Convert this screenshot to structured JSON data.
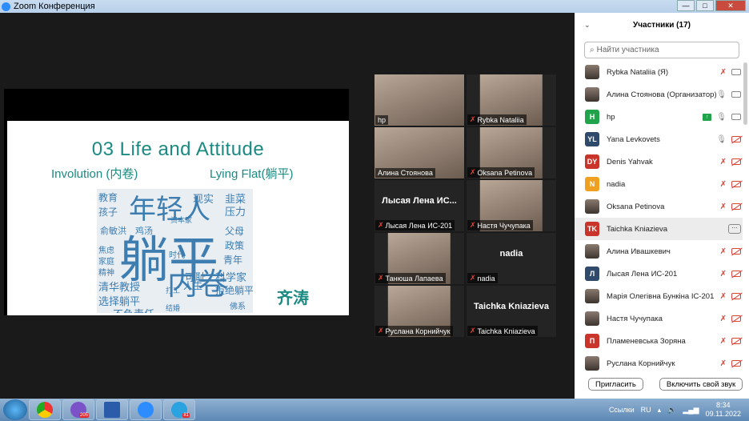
{
  "window": {
    "title": "Zoom Конференция"
  },
  "slide": {
    "title": "03 Life and Attitude",
    "sub_left": "Involution (内卷)",
    "sub_right": "Lying Flat(躺平)",
    "author": "齐涛",
    "cloud": [
      "躺平",
      "年轻人",
      "内卷",
      "教育",
      "孩子",
      "俞敏洪",
      "鸡汤",
      "现实",
      "韭菜",
      "压力",
      "父母",
      "政策",
      "青年",
      "科学家",
      "可耻",
      "拒绝躺平",
      "清华教授",
      "选择躺平",
      "不负责任",
      "人生",
      "精神",
      "家庭",
      "焦虑",
      "时代",
      "打工",
      "结婚",
      "佛系",
      "资本家"
    ]
  },
  "tiles": [
    {
      "name": "hp",
      "big": "",
      "video": true,
      "active": true,
      "muted": false
    },
    {
      "name": "Rybka Nataliia",
      "big": "",
      "video": true,
      "muted": true
    },
    {
      "name": "Алина Стоянова",
      "big": "",
      "video": true,
      "full": true,
      "muted": false
    },
    {
      "name": "Oksana Petinova",
      "big": "",
      "video": true,
      "muted": true
    },
    {
      "name": "Лысая Лена ИС-201",
      "big": "Лысая Лена ИС...",
      "video": false,
      "muted": true
    },
    {
      "name": "Настя Чучупака",
      "big": "",
      "video": true,
      "muted": true
    },
    {
      "name": "Танюша Лапаева",
      "big": "",
      "video": true,
      "muted": true
    },
    {
      "name": "nadia",
      "big": "nadia",
      "video": false,
      "muted": true
    },
    {
      "name": "Руслана Корнийчук",
      "big": "",
      "video": true,
      "muted": true
    },
    {
      "name": "Taichka Kniazieva",
      "big": "Taichka Kniazieva",
      "video": false,
      "muted": true
    }
  ],
  "panel": {
    "title": "Участники (17)",
    "search_placeholder": "Найти участника",
    "invite": "Пригласить",
    "unmute": "Включить свой звук",
    "more": "···",
    "participants": [
      {
        "name": "Rybka Nataliia (Я)",
        "initials": "",
        "color": "",
        "mic": "off",
        "cam": "on"
      },
      {
        "name": "Алина Стоянова (Организатор)",
        "initials": "",
        "color": "",
        "mic": "on",
        "cam": "on"
      },
      {
        "name": "hp",
        "initials": "H",
        "color": "#21a34b",
        "mic": "on",
        "cam": "on",
        "sharing": true
      },
      {
        "name": "Yana Levkovets",
        "initials": "YL",
        "color": "#2f4a6b",
        "mic": "on",
        "cam": "off"
      },
      {
        "name": "Denis Yahvak",
        "initials": "DY",
        "color": "#c9352b",
        "mic": "off",
        "cam": "off"
      },
      {
        "name": "nadia",
        "initials": "N",
        "color": "#f0a020",
        "mic": "off",
        "cam": "off"
      },
      {
        "name": "Oksana Petinova",
        "initials": "",
        "color": "",
        "mic": "off",
        "cam": "off"
      },
      {
        "name": "Taichka Kniazieva",
        "initials": "TK",
        "color": "#c9352b",
        "selected": true
      },
      {
        "name": "Алина Ивашкевич",
        "initials": "",
        "color": "",
        "mic": "off",
        "cam": "off"
      },
      {
        "name": "Лысая Лена ИС-201",
        "initials": "Л",
        "color": "#2f4a6b",
        "mic": "off",
        "cam": "off"
      },
      {
        "name": "Марія Олегівна Бункіна ІС-201",
        "initials": "",
        "color": "",
        "mic": "off",
        "cam": "off"
      },
      {
        "name": "Настя Чучупака",
        "initials": "",
        "color": "",
        "mic": "off",
        "cam": "off"
      },
      {
        "name": "Пламеневська Зоряна",
        "initials": "П",
        "color": "#c9352b",
        "mic": "off",
        "cam": "off"
      },
      {
        "name": "Руслана Корнийчук",
        "initials": "",
        "color": "",
        "mic": "off",
        "cam": "off"
      }
    ]
  },
  "taskbar": {
    "apps": [
      "chrome",
      "viber",
      "word",
      "zoom",
      "telegram"
    ],
    "viber_badge": "205",
    "telegram_badge": "81",
    "links": "Ссылки",
    "lang": "RU",
    "time": "8:34",
    "date": "09.11.2022"
  }
}
